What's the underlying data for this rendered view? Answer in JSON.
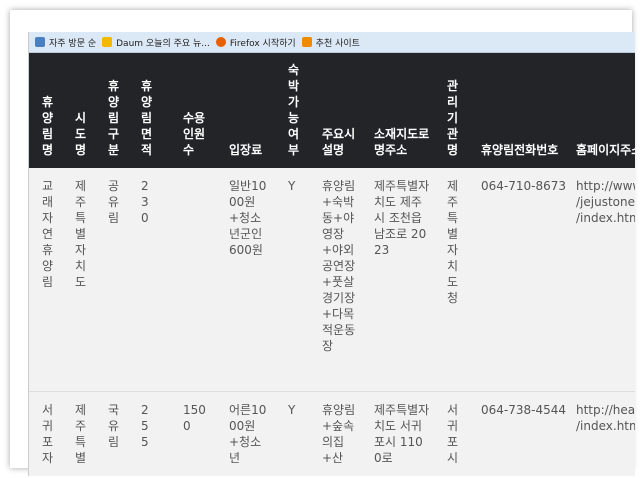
{
  "bookmarks": [
    {
      "label": "자주 방문 순",
      "icon": "frequent-icon",
      "color": "#4a7fc0"
    },
    {
      "label": "Daum 오늘의 주요 뉴...",
      "icon": "daum-icon",
      "color": "#f5b800"
    },
    {
      "label": "Firefox 시작하기",
      "icon": "firefox-icon",
      "color": "#e66000"
    },
    {
      "label": "추천 사이트",
      "icon": "recommended-icon",
      "color": "#f08a00"
    }
  ],
  "headers": [
    "휴양림명",
    "시도명",
    "휴양림구분",
    "휴양림면적",
    "수용인원수",
    "입장료",
    "숙박가능여부",
    "주요시설명",
    "소재지도로명주소",
    "관리기관명",
    "휴양림전화번호",
    "홈페이지주소"
  ],
  "rows": [
    [
      "교래자연휴양림",
      "제주특별자치도",
      "공유림",
      "230",
      "",
      "일반1000원+청소년군인600원",
      "Y",
      "휴양림+숙박동+야영장+야외공연장+풋살경기장+다목적운동장",
      "제주특별자치도 제주시 조천읍 남조로 2023",
      "제주특별자치도청",
      "064-710-8673",
      "http://www\n/jejustonep\n/index.htm"
    ],
    [
      "서귀포자",
      "제주특별",
      "국유림",
      "255",
      "1500",
      "어른1000원+청소년",
      "Y",
      "휴양림+숲속의집+산",
      "제주특별자치도 서귀포시 1100로",
      "서귀포시",
      "064-738-4544",
      "http://heali\n/index.htm"
    ]
  ]
}
